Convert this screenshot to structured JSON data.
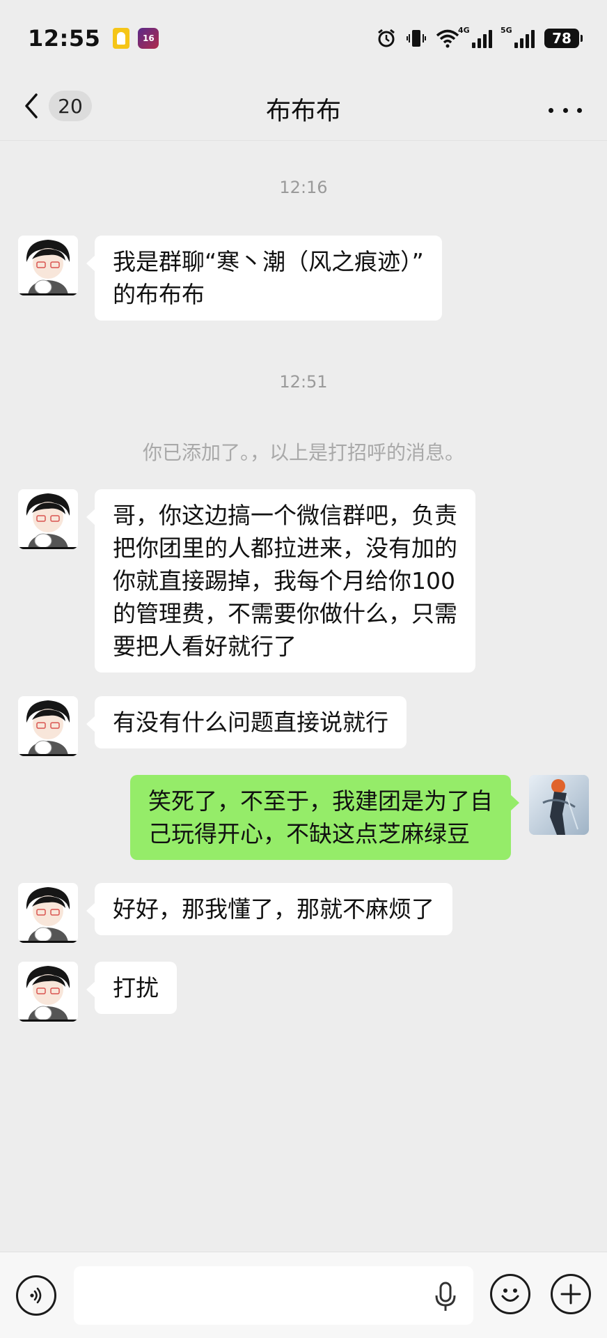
{
  "status_bar": {
    "time": "12:55",
    "app_badge": "16",
    "network_1": "4G",
    "network_2": "5G",
    "battery": "78"
  },
  "header": {
    "back_count": "20",
    "title": "布布布"
  },
  "chat": {
    "timestamp_1": "12:16",
    "msg_1": [
      "我是群聊“寒丶潮（风之痕迹）”",
      "的布布布"
    ],
    "timestamp_2": "12:51",
    "system_msg": "你已添加了。，以上是打招呼的消息。",
    "msg_2": [
      "哥，你这边搞一个微信群吧，负责",
      "把你团里的人都拉进来，没有加的",
      "你就直接踢掉，我每个月给你100",
      "的管理费，不需要你做什么，只需",
      "要把人看好就行了"
    ],
    "msg_3": [
      "有没有什么问题直接说就行"
    ],
    "msg_4_out": [
      "笑死了，不至于，我建团是为了自",
      "己玩得开心，不缺这点芝麻绿豆"
    ],
    "msg_5": [
      "好好，那我懂了，那就不麻烦了"
    ],
    "msg_6": [
      "打扰"
    ]
  },
  "input_bar": {
    "value": "",
    "icons": [
      "voice-icon",
      "mic-icon",
      "emoji-icon",
      "plus-icon"
    ]
  },
  "colors": {
    "background": "#ededed",
    "bubble_in": "#ffffff",
    "bubble_out": "#95ec69",
    "meta_text": "#9a9a9a"
  }
}
